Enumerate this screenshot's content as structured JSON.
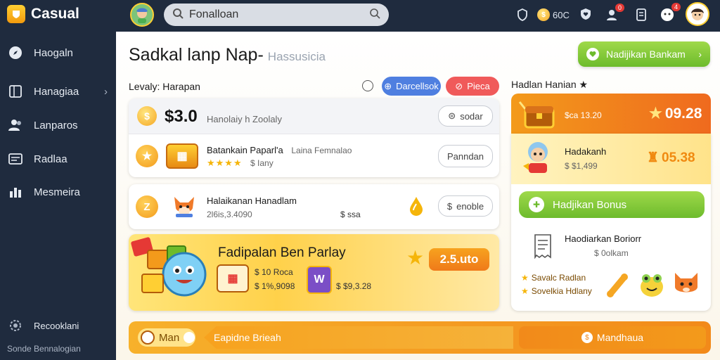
{
  "app": {
    "name": "Casual"
  },
  "search": {
    "value": "Fonalloan"
  },
  "topbar": {
    "coins": "60C",
    "notif_a": "0",
    "notif_b": "4"
  },
  "sidebar": {
    "items": [
      {
        "label": "Haogaln",
        "icon": "compass-icon"
      },
      {
        "label": "Hanagiaa",
        "icon": "grid-icon"
      },
      {
        "label": "Lanparos",
        "icon": "users-icon"
      },
      {
        "label": "Radlaa",
        "icon": "card-icon"
      },
      {
        "label": "Mesmeira",
        "icon": "chart-icon"
      }
    ],
    "footer_label": "Recooklani",
    "footer_sub": "Sonde Bennalogian"
  },
  "page": {
    "title": "Sadkal lanp Nap-",
    "subtitle": "Hassusicia",
    "cta": "Nadijikan Bankam"
  },
  "list": {
    "header": "Levaly: Harapan",
    "btn_blue": "Darcellsok",
    "btn_red": "Pieca",
    "balance": {
      "amount": "$3.0",
      "desc": "Hanolaiy h Zoolaly",
      "btn": "sodar"
    },
    "row1": {
      "title": "Batankain Paparl'a",
      "extra": "Laina Femnalao",
      "sub": "$ Iany",
      "btn": "Panndan"
    },
    "row2": {
      "title": "Halaikanan Hanadlam",
      "sub": "2l6is,3.4090",
      "price": "$ ssa",
      "btn": "enoble"
    },
    "promo": {
      "title": "Fadipalan Ben Parlay",
      "price": "2.5.uto",
      "meta1": "$ 10 Roca",
      "meta2": "$ 1%,9098",
      "meta3": "$ $9,3.28"
    }
  },
  "right": {
    "header": "Hadlan Hanian",
    "banner_meta": "$ca 13.20",
    "banner_score": "09.28",
    "user": {
      "name": "Hadakanh",
      "sub": "$ $1,499",
      "score": "05.38"
    },
    "bonus_btn": "Hadjikan Bonus",
    "reward": {
      "title": "Haodiarkan Boriorr",
      "sub": "$ 0olkam",
      "line1": "Savalc Radlan",
      "line2": "Sovelkia Hdlany"
    }
  },
  "bottom": {
    "label": "Man",
    "text": "Eapidne Brieah",
    "btn": "Mandhaua"
  },
  "colors": {
    "sidebar": "#1f2b3e",
    "accent_green": "#7ac43a",
    "accent_orange": "#f28a1a",
    "accent_blue": "#4f7fe0",
    "accent_red": "#f05a5a"
  }
}
